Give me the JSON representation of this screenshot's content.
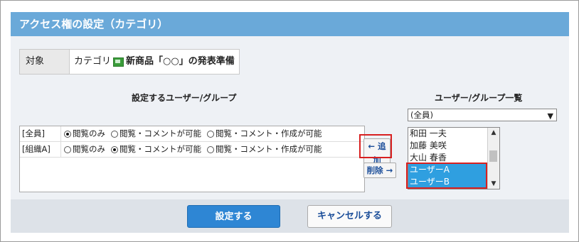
{
  "title": "アクセス権の設定（カテゴリ）",
  "target": {
    "label": "対象",
    "prefix": "カテゴリ",
    "name": "新商品「○○」の発表準備"
  },
  "left_section": {
    "label": "設定するユーザー/グループ"
  },
  "right_section": {
    "label": "ユーザー/グループ一覧"
  },
  "permissions": [
    {
      "who": "[全員]",
      "options": [
        "閲覧のみ",
        "閲覧・コメントが可能",
        "閲覧・コメント・作成が可能"
      ],
      "selected": 0
    },
    {
      "who": "[組織A]",
      "options": [
        "閲覧のみ",
        "閲覧・コメントが可能",
        "閲覧・コメント・作成が可能"
      ],
      "selected": 1
    }
  ],
  "buttons": {
    "add": "← 追加",
    "remove": "削除 →",
    "submit": "設定する",
    "cancel": "キャンセルする"
  },
  "group_select": {
    "value": "(全員)"
  },
  "user_list": [
    {
      "name": "和田 一夫",
      "selected": false
    },
    {
      "name": "加藤 美咲",
      "selected": false
    },
    {
      "name": "大山 春香",
      "selected": false
    },
    {
      "name": "ユーザーA",
      "selected": true
    },
    {
      "name": "ユーザーB",
      "selected": true
    }
  ],
  "colors": {
    "title_bar": "#6aa9d9",
    "highlight": "#d82020",
    "selection": "#2f9fe0",
    "primary": "#2e86d4"
  }
}
